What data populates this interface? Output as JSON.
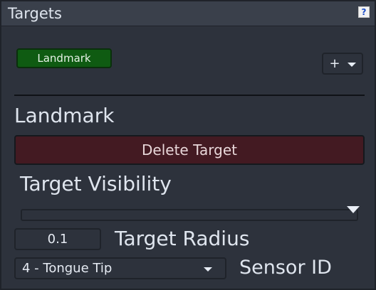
{
  "panel": {
    "title": "Targets",
    "help_icon": "question-icon"
  },
  "targets": {
    "chips": [
      {
        "label": "Landmark",
        "color": "#0f5b12"
      }
    ],
    "add_button": {
      "label": "+",
      "icon": "chevron-down-icon"
    }
  },
  "selected": {
    "name": "Landmark",
    "delete_label": "Delete Target",
    "visibility_label": "Target Visibility",
    "visibility_value": 1.0,
    "radius_label": "Target Radius",
    "radius_value": "0.1",
    "sensor_label": "Sensor ID",
    "sensor_selected": "4 - Tongue Tip"
  },
  "colors": {
    "delete_bg": "#431a22",
    "panel_bg": "#2d323c"
  }
}
